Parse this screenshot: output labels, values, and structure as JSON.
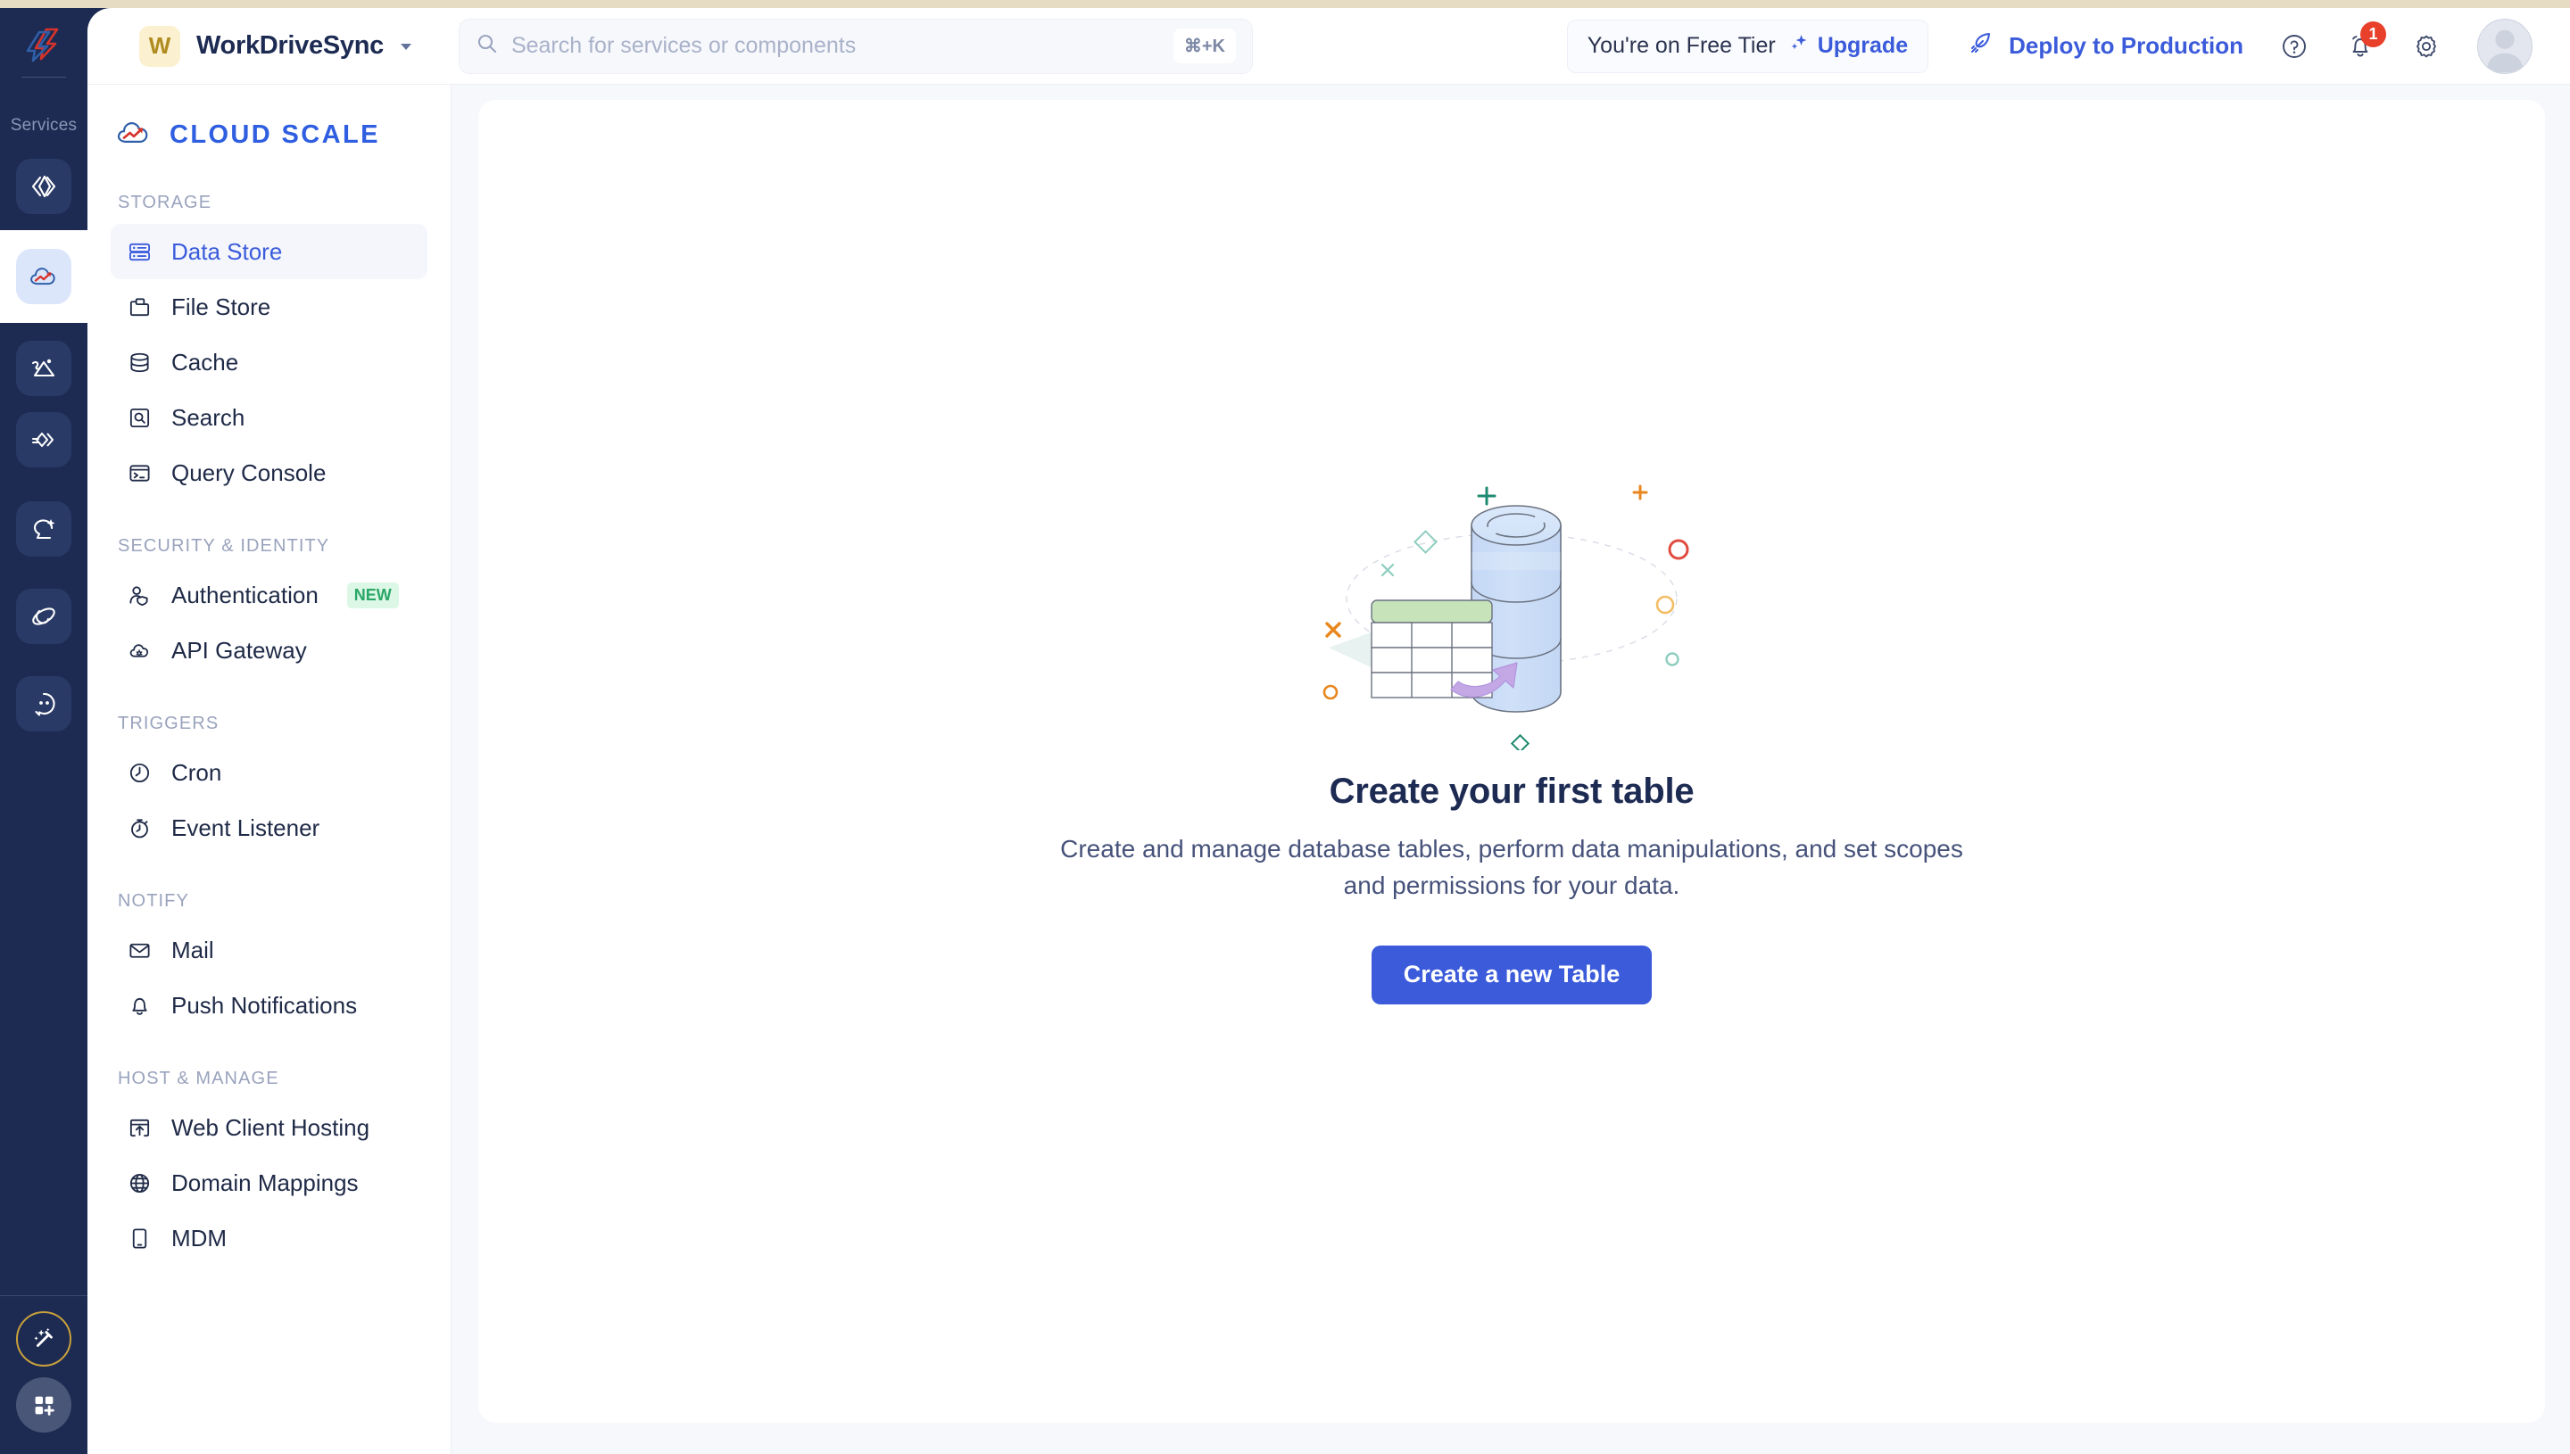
{
  "colors": {
    "accent": "#3b5bdb",
    "rail_bg": "#1d2b53",
    "top_strip": "#e6dcc3",
    "badge_new": "#2aa767",
    "notification": "#e8402a",
    "project_badge_bg": "#fbf0cf",
    "project_badge_fg": "#b08c20",
    "main_bg": "#f7f8fc"
  },
  "rail": {
    "services_label": "Services",
    "logo_icon": "zoho-logo-icon",
    "items": [
      {
        "icon": "code-brackets-icon",
        "active": false
      },
      {
        "icon": "cloud-scale-icon",
        "active": true
      },
      {
        "icon": "analytics-icon",
        "active": false
      },
      {
        "icon": "flow-connect-icon",
        "active": false
      },
      {
        "icon": "chat-sparkle-icon",
        "active": false
      },
      {
        "icon": "orbit-icon",
        "active": false
      },
      {
        "icon": "comment-dots-icon",
        "active": false
      }
    ],
    "magic_icon": "magic-wand-icon",
    "apps_icon": "apps-grid-plus-icon"
  },
  "header": {
    "project_initial": "W",
    "project_name": "WorkDriveSync",
    "project_caret": "chevron-down-icon",
    "search": {
      "placeholder": "Search for services or components",
      "value": "",
      "icon": "search-icon",
      "shortcut": "⌘+K"
    },
    "tier_text": "You're on Free Tier",
    "upgrade_label": "Upgrade",
    "upgrade_icon": "sparkle-icon",
    "deploy_label": "Deploy to Production",
    "deploy_icon": "rocket-icon",
    "help_icon": "help-circle-icon",
    "notifications_icon": "bell-icon",
    "notifications_count": "1",
    "settings_icon": "gear-icon",
    "avatar_icon": "user-avatar"
  },
  "sidebar": {
    "brand": "CLOUD SCALE",
    "brand_icon": "cloud-scale-icon",
    "sections": [
      {
        "title": "STORAGE",
        "items": [
          {
            "label": "Data Store",
            "icon": "data-store-icon",
            "active": true,
            "badge": ""
          },
          {
            "label": "File Store",
            "icon": "file-store-icon",
            "active": false,
            "badge": ""
          },
          {
            "label": "Cache",
            "icon": "cache-icon",
            "active": false,
            "badge": ""
          },
          {
            "label": "Search",
            "icon": "search-box-icon",
            "active": false,
            "badge": ""
          },
          {
            "label": "Query Console",
            "icon": "query-console-icon",
            "active": false,
            "badge": ""
          }
        ]
      },
      {
        "title": "SECURITY & IDENTITY",
        "items": [
          {
            "label": "Authentication",
            "icon": "authentication-icon",
            "active": false,
            "badge": "NEW"
          },
          {
            "label": "API Gateway",
            "icon": "api-gateway-icon",
            "active": false,
            "badge": ""
          }
        ]
      },
      {
        "title": "TRIGGERS",
        "items": [
          {
            "label": "Cron",
            "icon": "clock-icon",
            "active": false,
            "badge": ""
          },
          {
            "label": "Event Listener",
            "icon": "stopwatch-icon",
            "active": false,
            "badge": ""
          }
        ]
      },
      {
        "title": "NOTIFY",
        "items": [
          {
            "label": "Mail",
            "icon": "mail-icon",
            "active": false,
            "badge": ""
          },
          {
            "label": "Push Notifications",
            "icon": "bell-icon",
            "active": false,
            "badge": ""
          }
        ]
      },
      {
        "title": "HOST & MANAGE",
        "items": [
          {
            "label": "Web Client Hosting",
            "icon": "web-hosting-icon",
            "active": false,
            "badge": ""
          },
          {
            "label": "Domain Mappings",
            "icon": "globe-icon",
            "active": false,
            "badge": ""
          },
          {
            "label": "MDM",
            "icon": "mobile-device-icon",
            "active": false,
            "badge": ""
          }
        ]
      }
    ]
  },
  "main": {
    "empty_state": {
      "illustration": "database-table-illustration",
      "title": "Create your first table",
      "description": "Create and manage database tables, perform data manipulations, and set scopes and permissions for your data.",
      "button_label": "Create a new Table"
    }
  }
}
